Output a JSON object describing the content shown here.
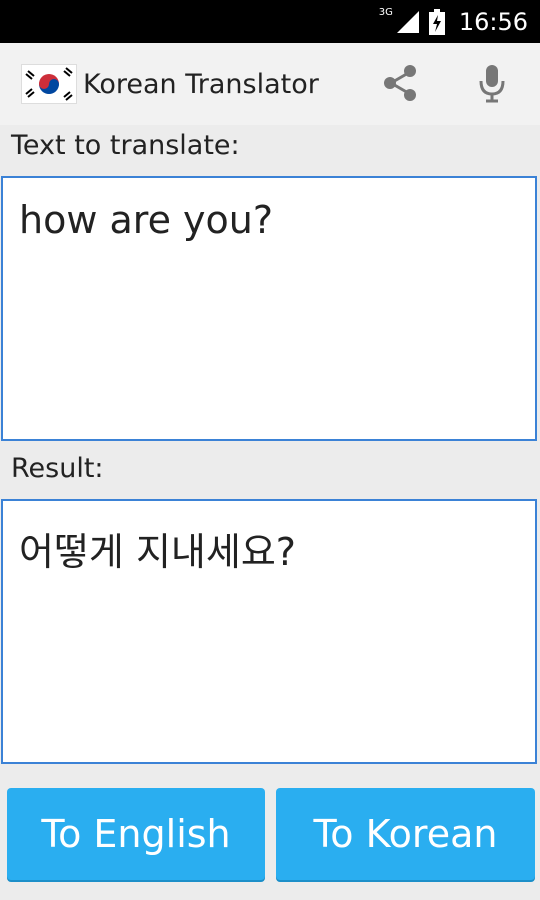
{
  "status_bar": {
    "network": "3G",
    "time": "16:56"
  },
  "action_bar": {
    "title": "Korean Translator",
    "share_icon": "share-icon",
    "mic_icon": "microphone-icon"
  },
  "input": {
    "label": "Text to translate:",
    "value": "how are you?"
  },
  "result": {
    "label": "Result:",
    "value": "어떻게 지내세요?"
  },
  "buttons": {
    "to_english": "To English",
    "to_korean": "To Korean"
  },
  "colors": {
    "accent": "#2aaef0",
    "border": "#3b82d6",
    "background": "#ececec"
  }
}
